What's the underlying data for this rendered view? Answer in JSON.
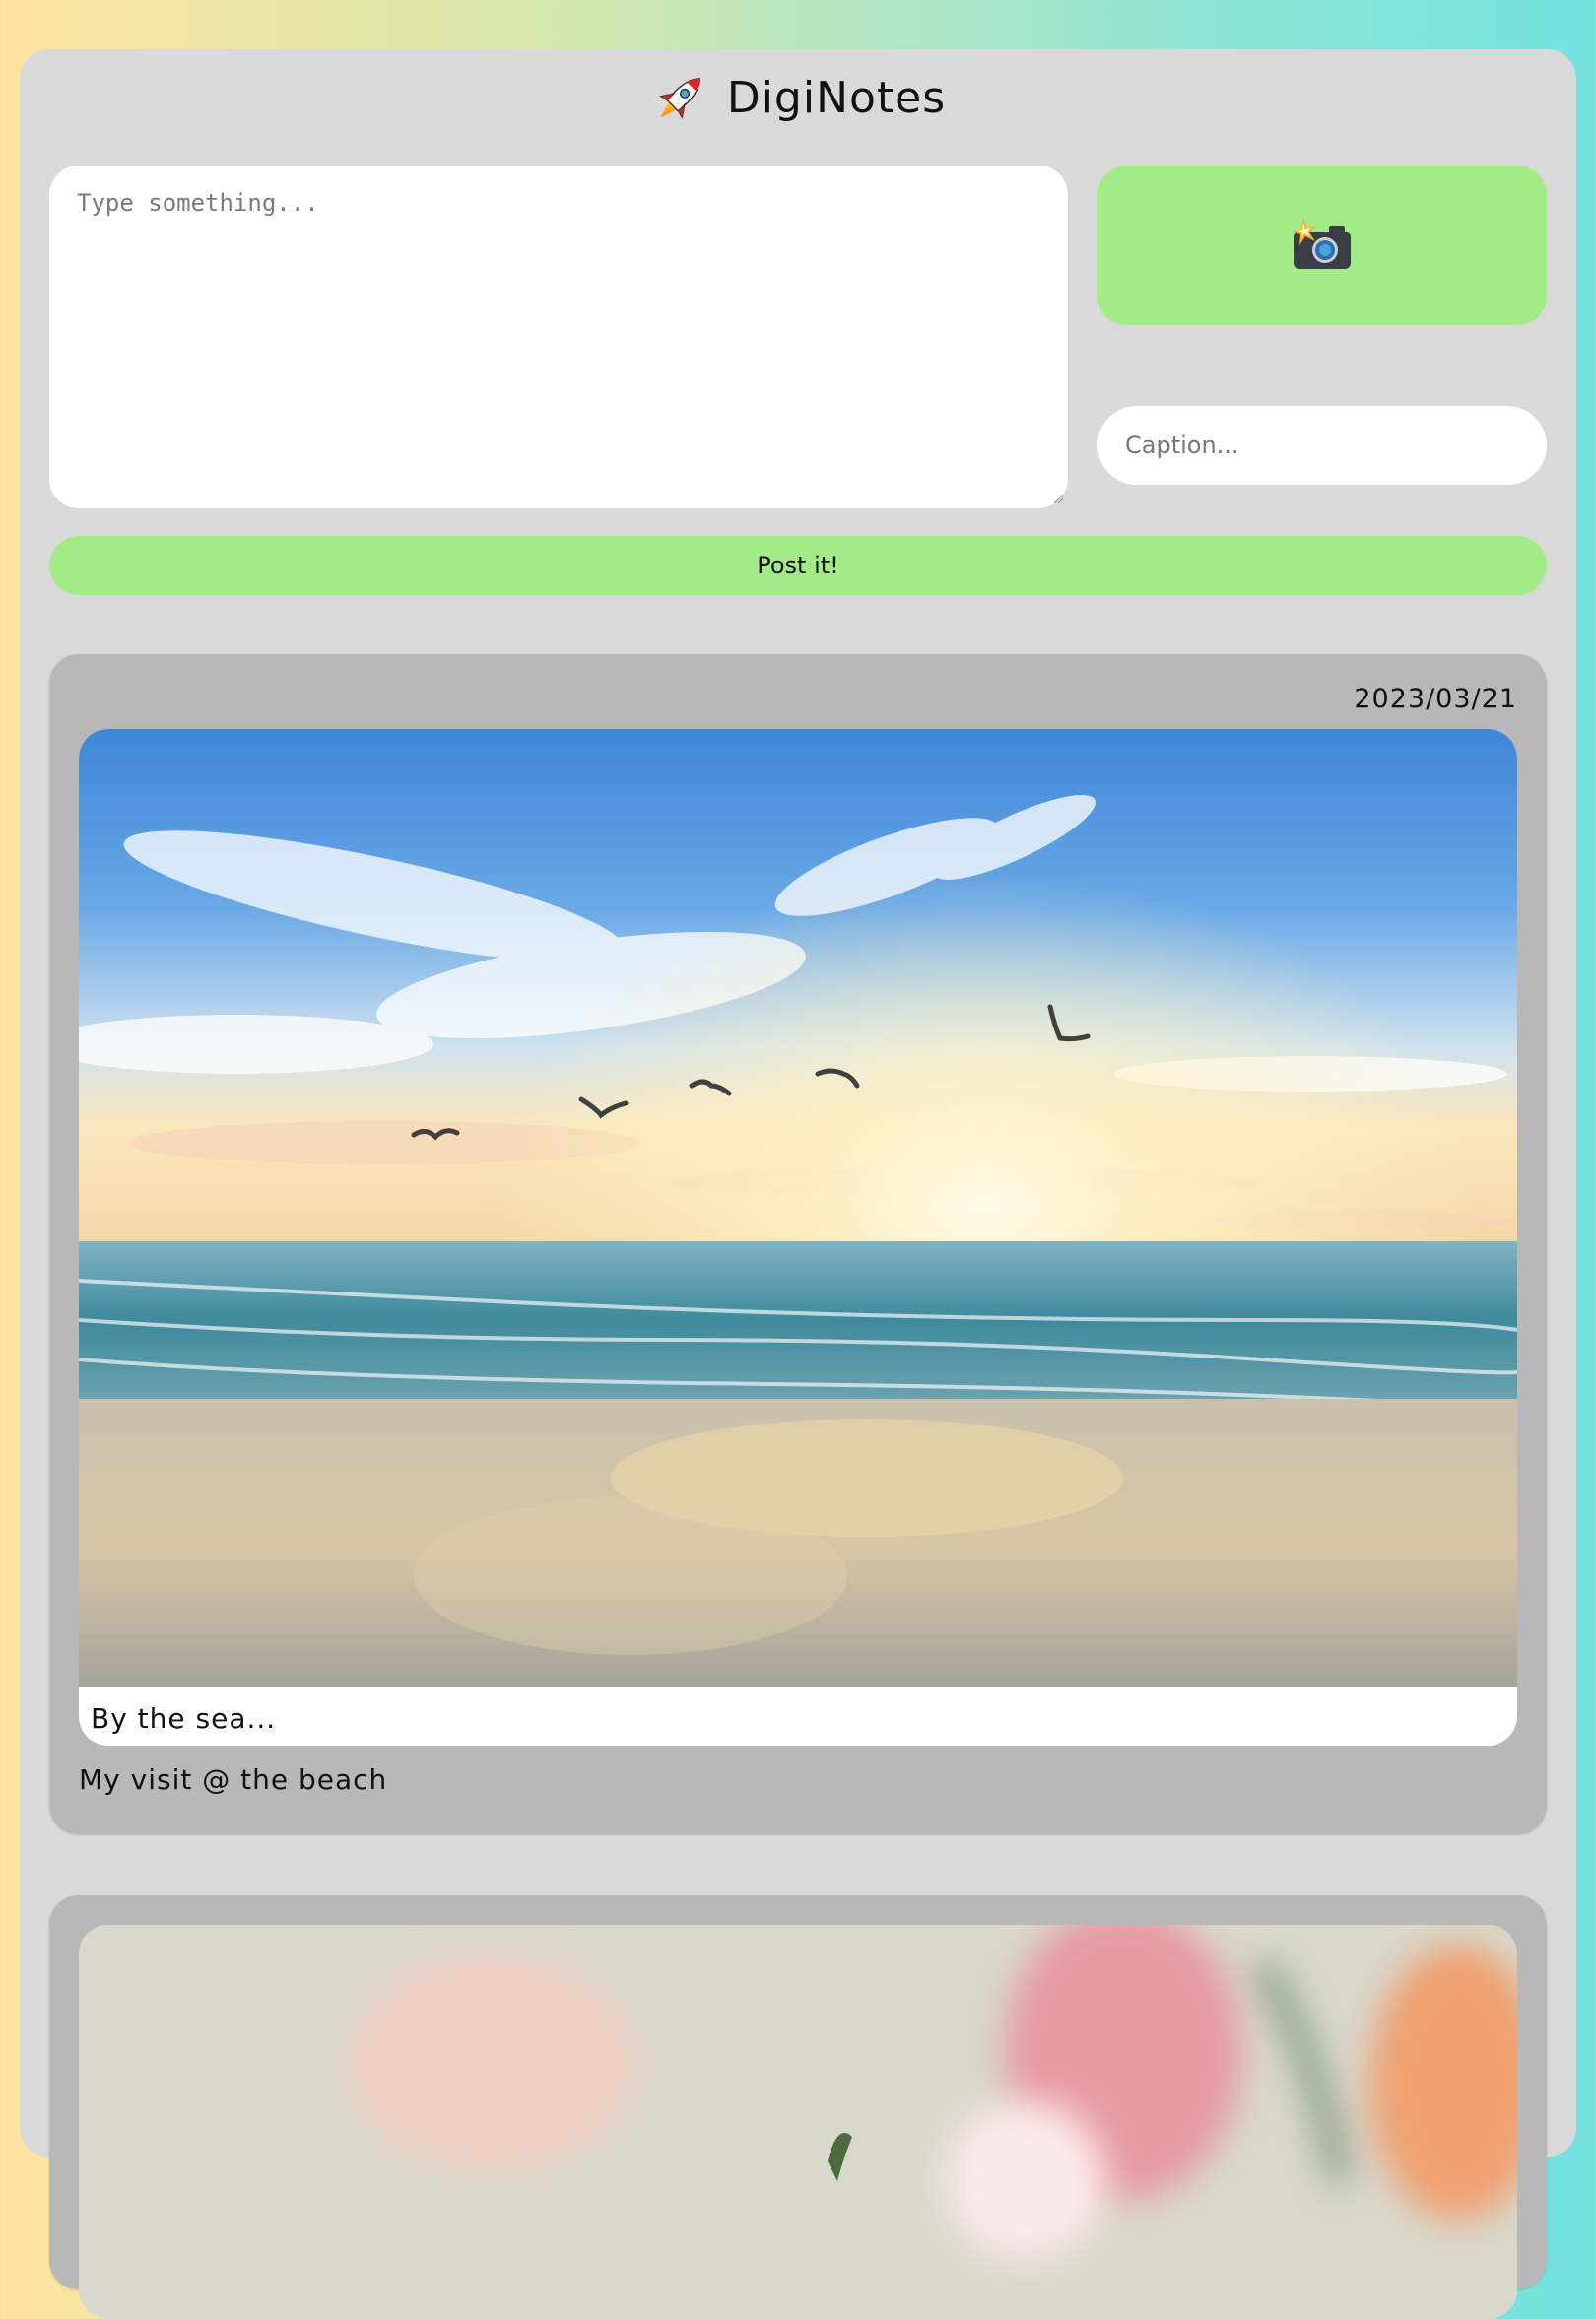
{
  "app": {
    "title": "DigiNotes",
    "logo_icon": "rocket-icon"
  },
  "composer": {
    "note_placeholder": "Type something...",
    "note_value": "",
    "camera_icon": "camera-with-flash-icon",
    "caption_placeholder": "Caption...",
    "caption_value": "",
    "post_label": "Post it!"
  },
  "colors": {
    "accent_green": "#a3eb86",
    "panel_gray": "#d9d9d9",
    "card_gray": "#b8b8b8"
  },
  "posts": [
    {
      "date": "2023/03/21",
      "photo": "beach-sunset-photo",
      "caption": "By the sea...",
      "text": "My visit @ the beach"
    },
    {
      "photo": "flowers-photo"
    }
  ]
}
